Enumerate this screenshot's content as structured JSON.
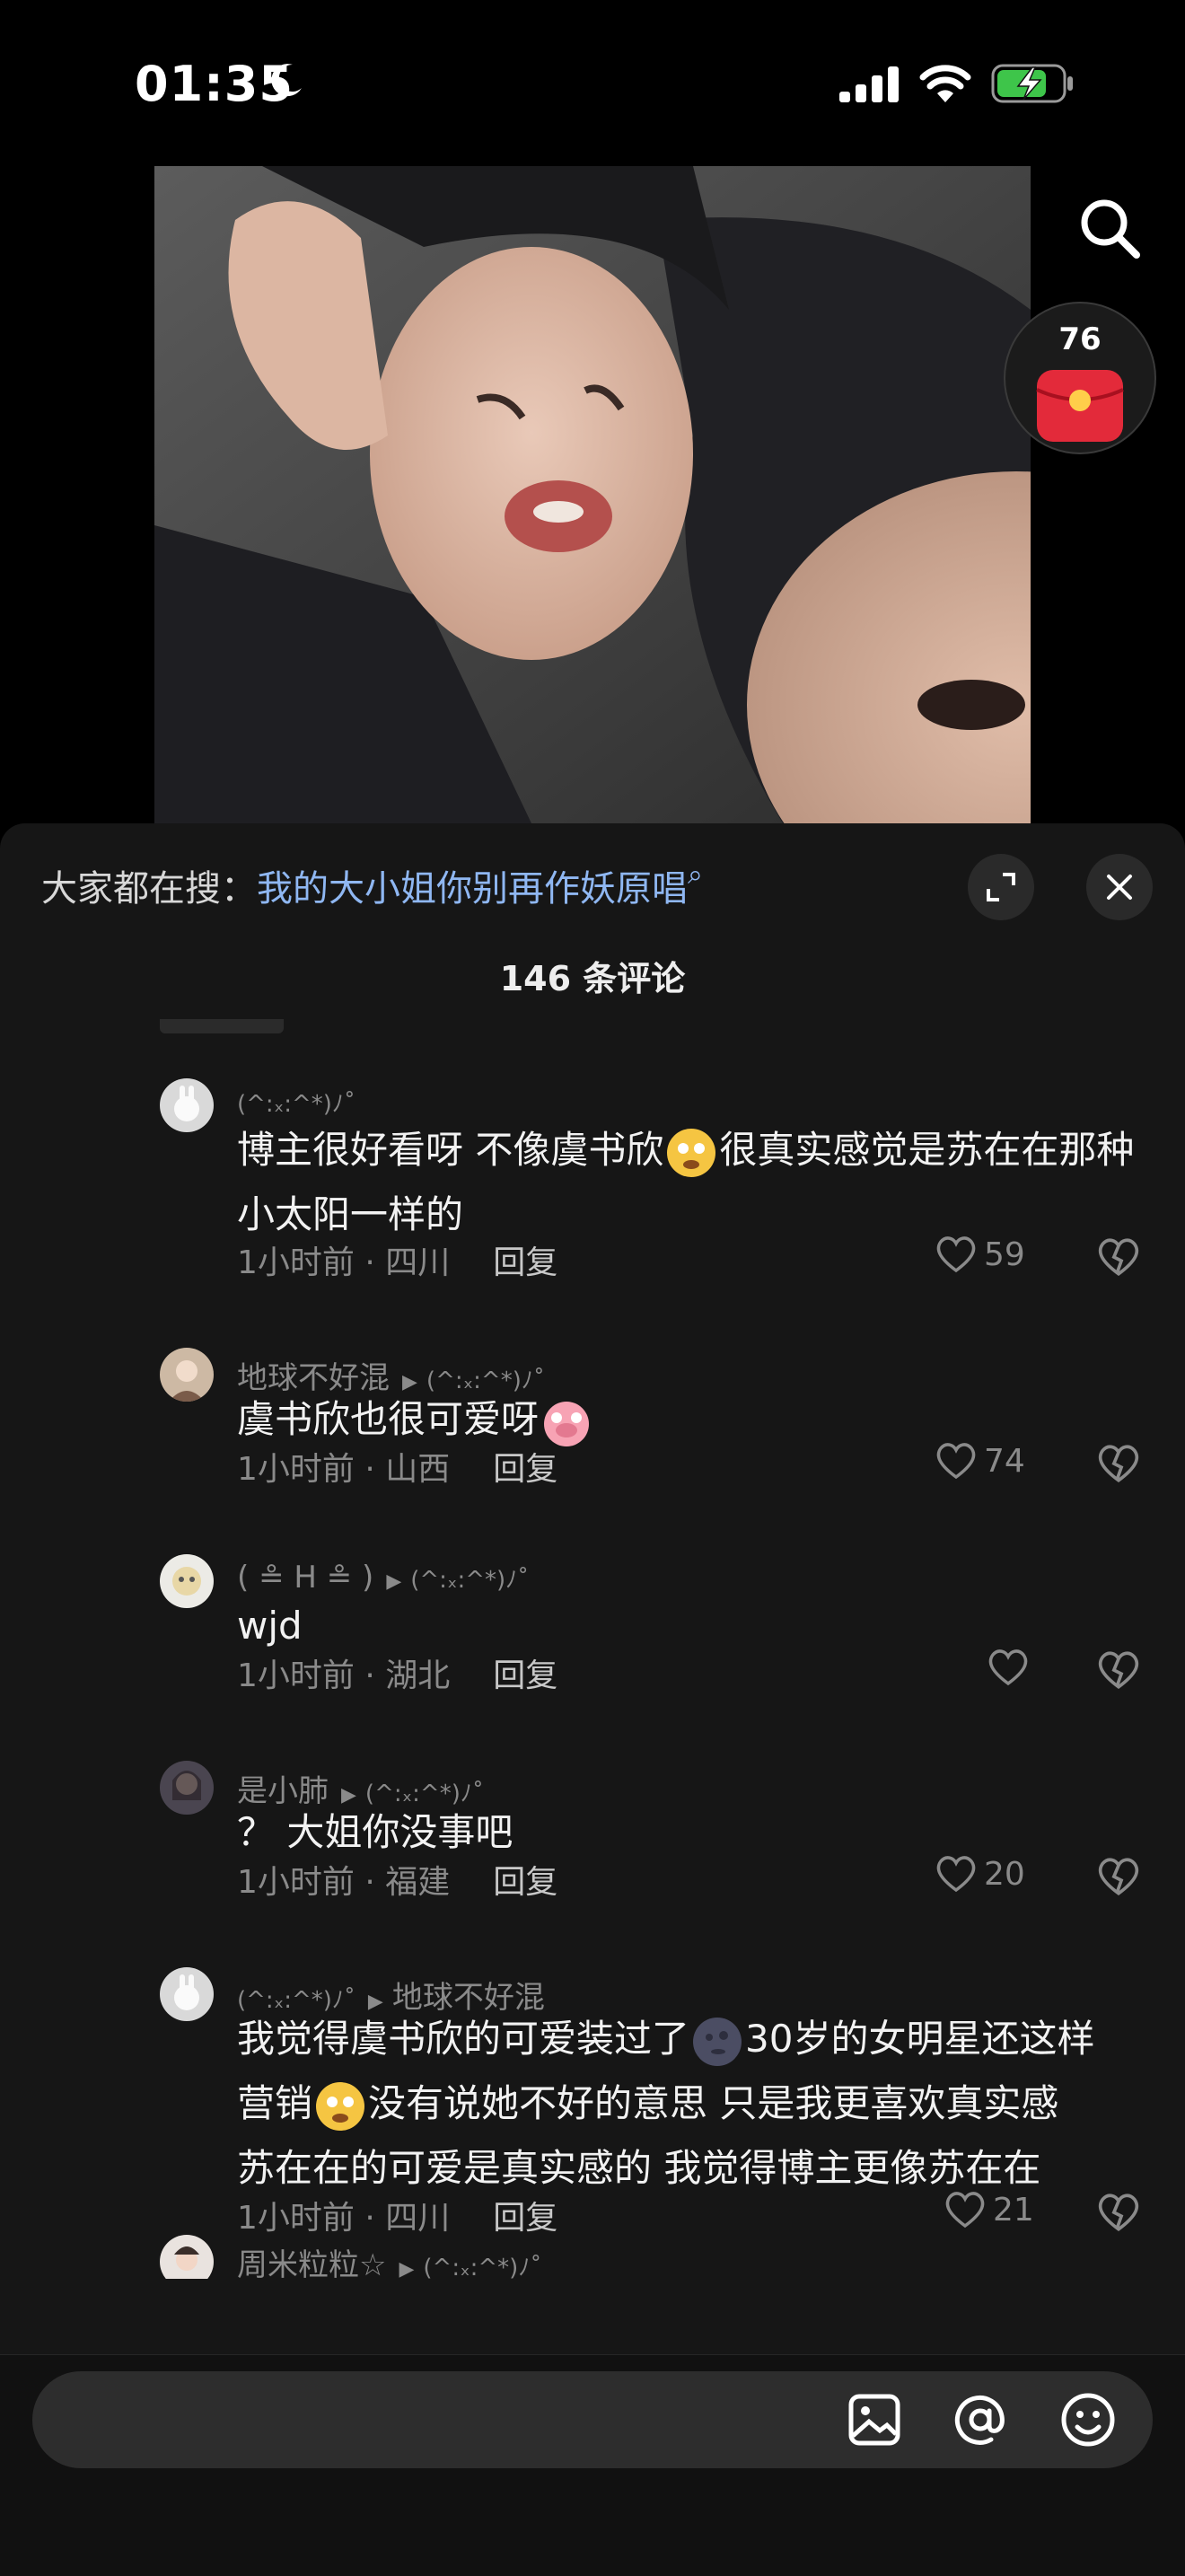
{
  "status": {
    "time": "01:35"
  },
  "red_packet": {
    "count": "76"
  },
  "hot_search": {
    "prefix": "大家都在搜：",
    "query": "我的大小姐你别再作妖原唱"
  },
  "comment_count": "146 条评论",
  "comments": [
    {
      "user": "(^:ₓ:^*)ﾉ˚",
      "reply_to": "",
      "text": "博主很好看呀 不像虞书欣",
      "text2": "很真实感觉是苏在在那种小太阳一样的",
      "time_loc": "1小时前 · 四川",
      "reply_label": "回复",
      "likes": "59"
    },
    {
      "user": "地球不好混",
      "reply_to": "(^:ₓ:^*)ﾉ˚",
      "text": "虞书欣也很可爱呀",
      "time_loc": "1小时前 · 山西",
      "reply_label": "回复",
      "likes": "74"
    },
    {
      "user": "( ≗ H ≗ )",
      "reply_to": "(^:ₓ:^*)ﾉ˚",
      "text": "wjd",
      "time_loc": "1小时前 · 湖北",
      "reply_label": "回复",
      "likes": ""
    },
    {
      "user": "是小肺",
      "reply_to": "(^:ₓ:^*)ﾉ˚",
      "text": "？ 大姐你没事吧",
      "time_loc": "1小时前 · 福建",
      "reply_label": "回复",
      "likes": "20"
    },
    {
      "user": "(^:ₓ:^*)ﾉ˚",
      "reply_to": "地球不好混",
      "text_a": "我觉得虞书欣的可爱装过了",
      "text_b": "30岁的女明星还这样",
      "text_c": "营销",
      "text_d": "没有说她不好的意思 只是我更喜欢真实感",
      "text_e": "苏在在的可爱是真实感的 我觉得博主更像苏在在",
      "time_loc": "1小时前 · 四川",
      "reply_label": "回复",
      "likes": "21"
    },
    {
      "user": "周米粒粒☆",
      "reply_to": "(^:ₓ:^*)ﾉ˚"
    }
  ],
  "input": {
    "placeholder": ""
  },
  "colors": {
    "sheet_bg": "#161616",
    "link": "#8fb7f2",
    "muted": "#8a8a8a"
  },
  "icons": [
    "moon-icon",
    "signal-icon",
    "wifi-icon",
    "battery-charging-icon",
    "search-icon",
    "red-packet-icon",
    "expand-icon",
    "close-icon",
    "heart-icon",
    "dislike-icon",
    "image-icon",
    "at-icon",
    "emoji-icon"
  ]
}
